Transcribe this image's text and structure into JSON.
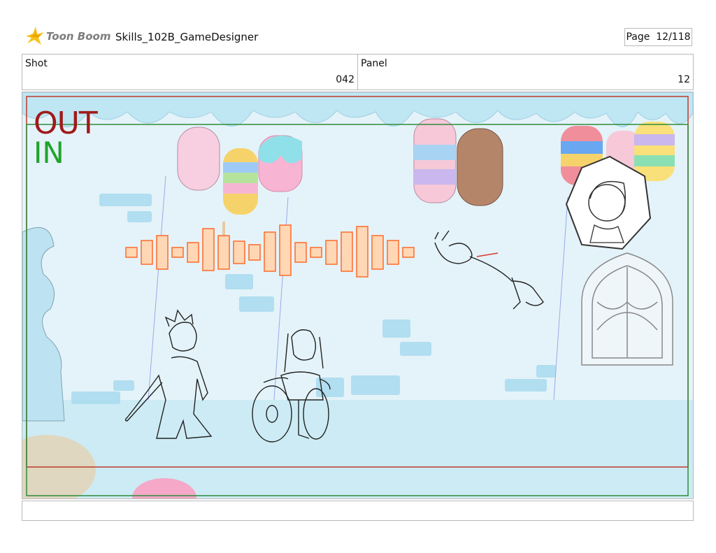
{
  "header": {
    "brand": "Toon Boom",
    "project": "Skills_102B_GameDesigner",
    "page_label": "Page",
    "page_value": "12/118"
  },
  "shot": {
    "label": "Shot",
    "value": "042"
  },
  "panel": {
    "label": "Panel",
    "value": "12"
  },
  "frame": {
    "out_label": "OUT",
    "in_label": "IN"
  },
  "colors": {
    "out_border": "#c0392b",
    "in_border": "#2e8b3a",
    "sky": "#d8eef6",
    "icing": "#bfe6f3",
    "soundwave": "#ff7a3c"
  },
  "icons": [
    "toon-boom-logo",
    "audio-soundwave",
    "character-inset-portrait"
  ]
}
